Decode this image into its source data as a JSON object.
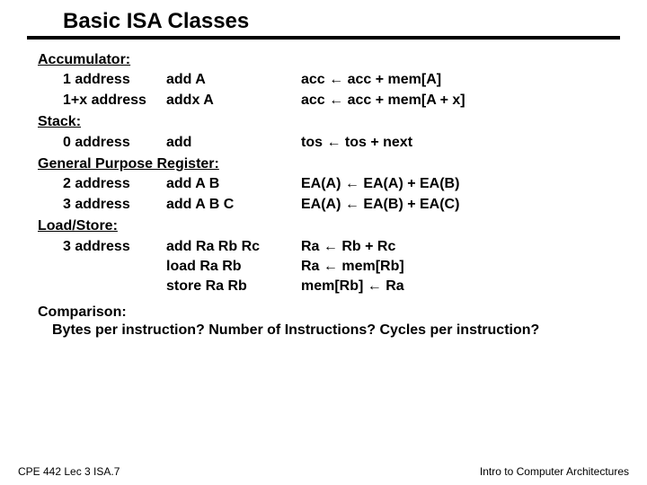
{
  "title": "Basic ISA Classes",
  "sections": {
    "accumulator": {
      "label": "Accumulator:",
      "rows": [
        {
          "addr": "1 address",
          "instr": "add A",
          "sem": "acc ← acc + mem[A]"
        },
        {
          "addr": "1+x address",
          "instr": "addx A",
          "sem": "acc ← acc + mem[A + x]"
        }
      ]
    },
    "stack": {
      "label": "Stack:",
      "rows": [
        {
          "addr": "0 address",
          "instr": "add",
          "sem": "tos ← tos + next"
        }
      ]
    },
    "gpr": {
      "label": "General Purpose Register:",
      "rows": [
        {
          "addr": "2 address",
          "instr": "add A B",
          "sem": "EA(A) ← EA(A) + EA(B)"
        },
        {
          "addr": "3 address",
          "instr": "add A B C",
          "sem": "EA(A) ← EA(B) + EA(C)"
        }
      ]
    },
    "loadstore": {
      "label": "Load/Store:",
      "rows": [
        {
          "addr": "3 address",
          "instr": "add Ra Rb Rc",
          "sem": "Ra ← Rb + Rc"
        },
        {
          "addr": "",
          "instr": "load Ra Rb",
          "sem": "Ra ← mem[Rb]"
        },
        {
          "addr": "",
          "instr": "store Ra Rb",
          "sem": "mem[Rb] ← Ra"
        }
      ]
    }
  },
  "comparison": {
    "label": "Comparison:",
    "text": "Bytes per instruction?  Number of Instructions?  Cycles per instruction?"
  },
  "footer": {
    "left": "CPE 442 Lec 3 ISA.7",
    "right": "Intro to Computer Architectures"
  }
}
